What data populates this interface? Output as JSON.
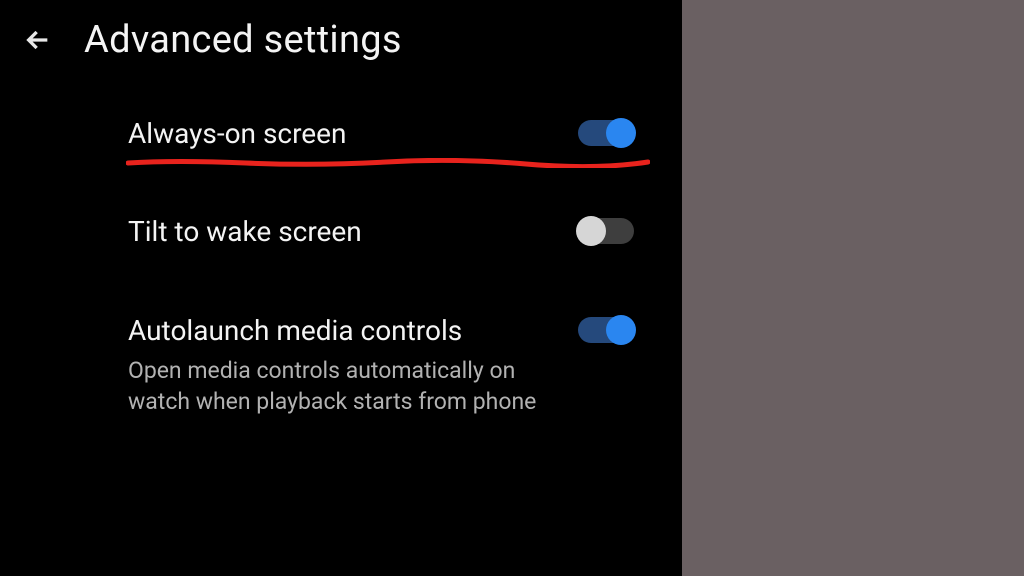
{
  "header": {
    "title": "Advanced settings"
  },
  "settings": [
    {
      "title": "Always-on screen",
      "desc": "",
      "enabled": true,
      "annotated": true
    },
    {
      "title": "Tilt to wake screen",
      "desc": "",
      "enabled": false,
      "annotated": false
    },
    {
      "title": "Autolaunch media controls",
      "desc": "Open media controls automatically on watch when playback starts from phone",
      "enabled": true,
      "annotated": false
    }
  ],
  "colors": {
    "accent_on": "#2a86f0",
    "track_on": "#25497c",
    "knob_off": "#d6d6d6",
    "track_off": "#3e3e3e",
    "annotation": "#e8231d"
  }
}
